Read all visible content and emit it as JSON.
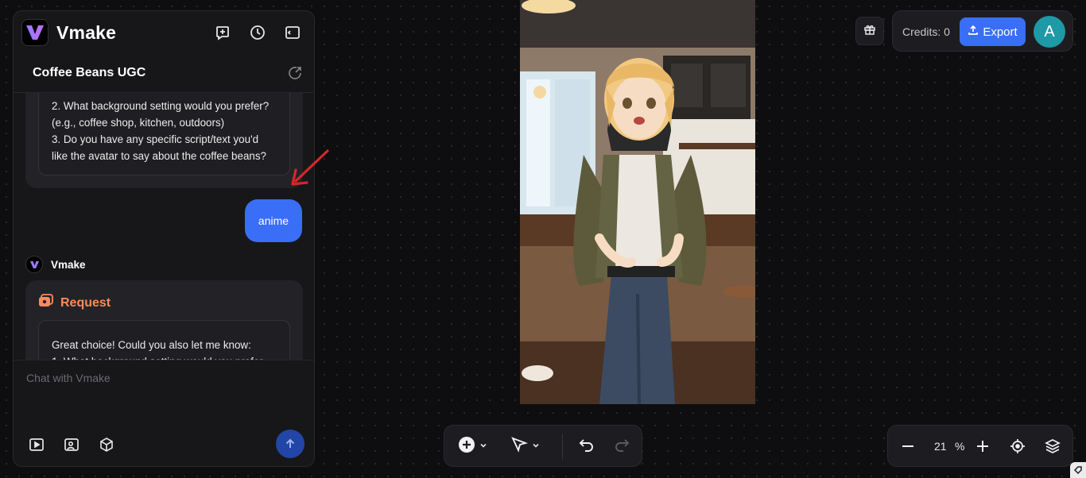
{
  "app": {
    "name": "Vmake"
  },
  "project": {
    "title": "Coffee Beans UGC"
  },
  "chat": {
    "first_message_lines": [
      "2. What background setting would you prefer? (e.g., coffee shop, kitchen, outdoors)",
      "3. Do you have any specific script/text you'd like the avatar to say about the coffee beans?"
    ],
    "user_message": "anime",
    "sender_name": "Vmake",
    "request_label": "Request",
    "second_message_lines": [
      "Great choice! Could you also let me know:",
      "1. What background setting would you prefer"
    ],
    "input_placeholder": "Chat with Vmake"
  },
  "header": {
    "credits_label": "Credits: 0",
    "export_label": "Export",
    "avatar_initial": "A"
  },
  "zoom": {
    "value": "21",
    "unit": "%"
  },
  "colors": {
    "accent": "#3a6ef6",
    "request": "#ff8a5c",
    "avatar": "#1d9aa6",
    "arrow": "#d62828"
  }
}
